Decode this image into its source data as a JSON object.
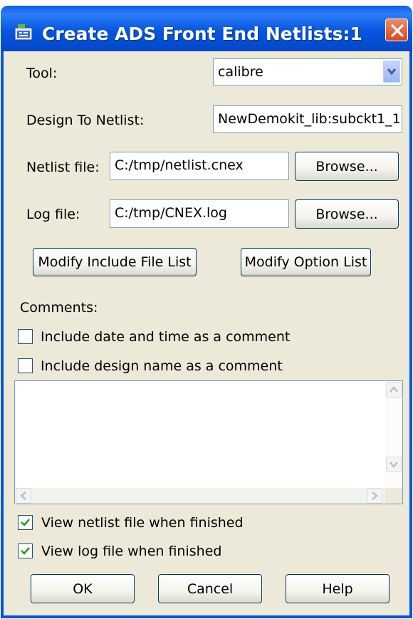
{
  "window": {
    "title": "Create ADS Front End Netlists:1",
    "icon": "ads-app-icon",
    "close_icon": "close-icon"
  },
  "form": {
    "tool_label": "Tool:",
    "tool_value": "calibre",
    "design_label": "Design To Netlist:",
    "design_value": "NewDemokit_lib:subckt1_1",
    "netlist_label": "Netlist file:",
    "netlist_value": "C:/tmp/netlist.cnex",
    "log_label": "Log file:",
    "log_value": "C:/tmp/CNEX.log",
    "browse_label": "Browse...",
    "modify_include_label": "Modify Include File List",
    "modify_option_label": "Modify Option List",
    "comments_label": "Comments:",
    "include_date_label": "Include date and time as a comment",
    "include_date_checked": false,
    "include_design_label": "Include design name as a comment",
    "include_design_checked": false,
    "comments_text": "",
    "view_netlist_label": "View netlist file when finished",
    "view_netlist_checked": true,
    "view_log_label": "View log file when finished",
    "view_log_checked": true
  },
  "buttons": {
    "ok": "OK",
    "cancel": "Cancel",
    "help": "Help"
  },
  "colors": {
    "titlebar": "#0553d9",
    "dialog_bg": "#ece9d8",
    "check_green": "#21a121"
  }
}
